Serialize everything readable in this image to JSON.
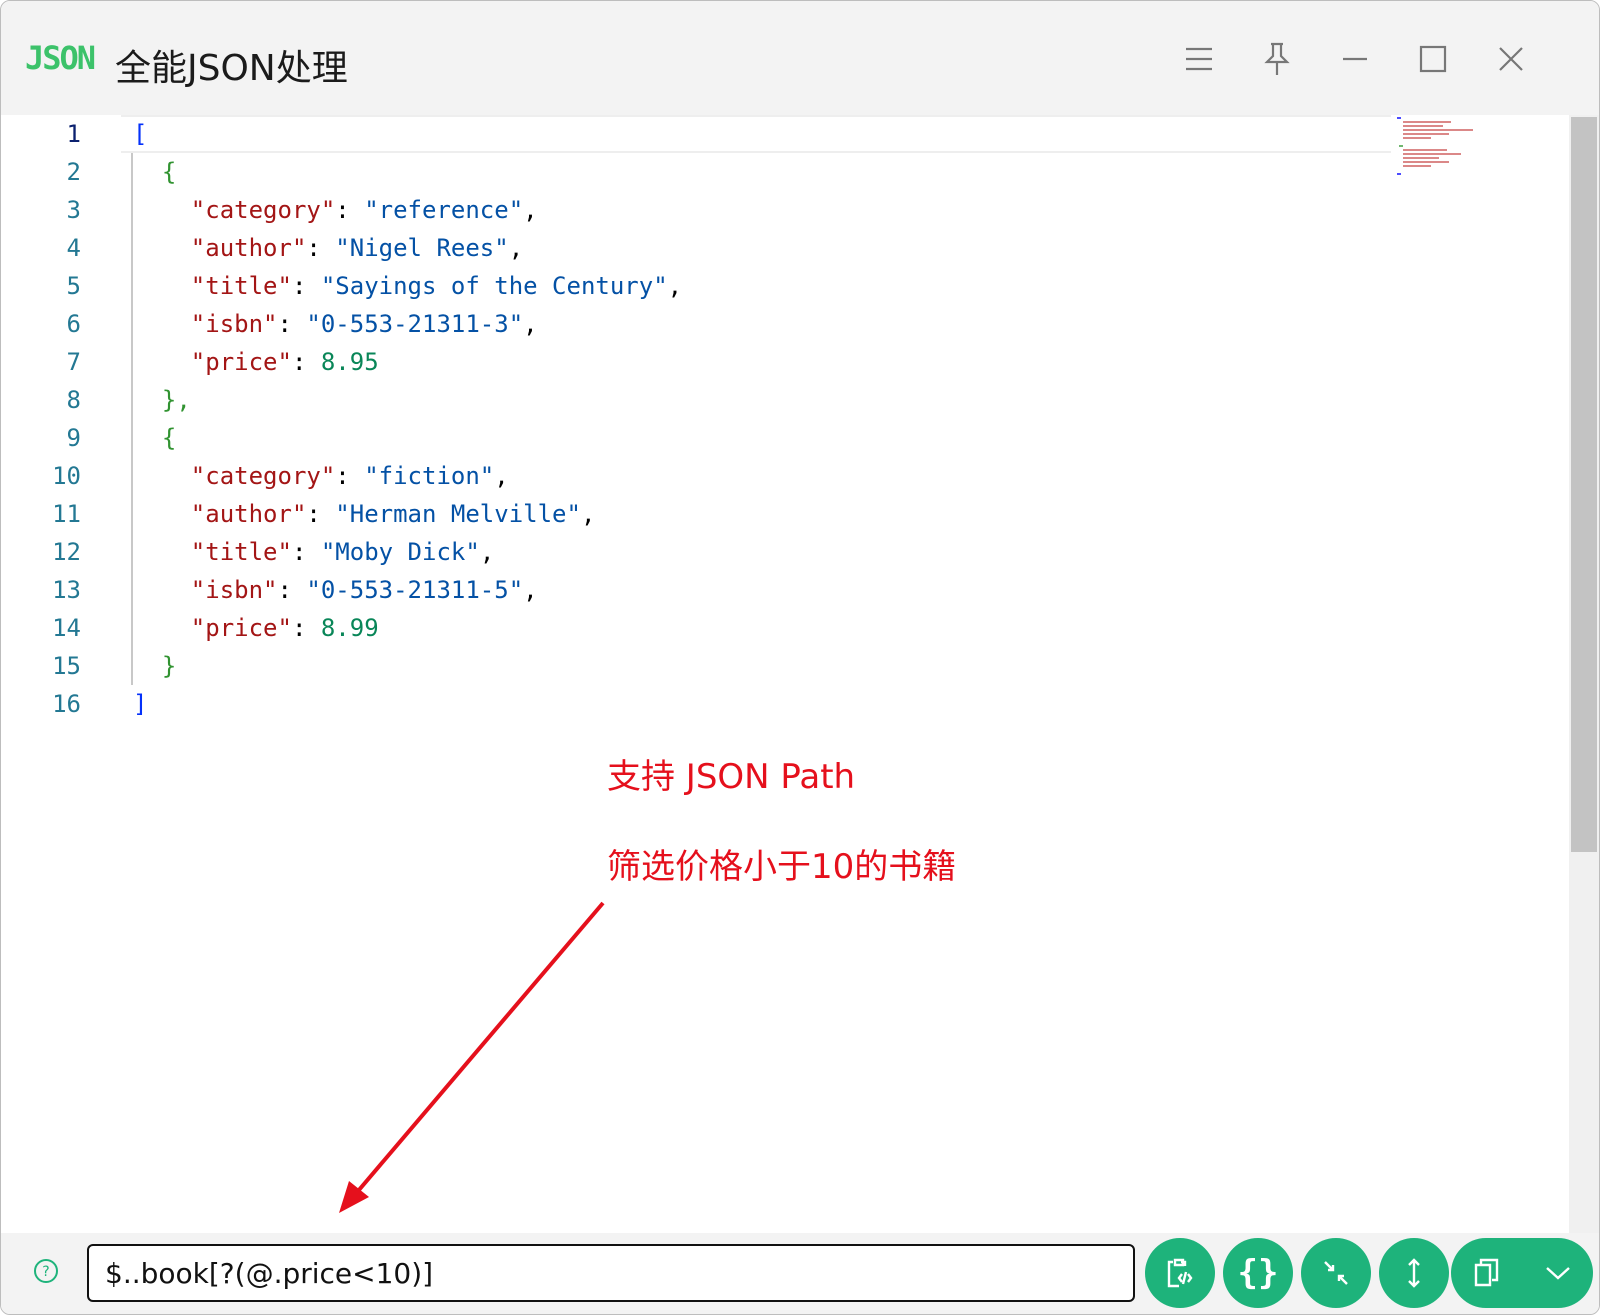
{
  "titlebar": {
    "logo": "JSON",
    "title": "全能JSON处理",
    "buttons": [
      "menu-icon",
      "pin-icon",
      "minimize-icon",
      "maximize-icon",
      "close-icon"
    ]
  },
  "editor": {
    "lines": [
      {
        "num": "1"
      },
      {
        "num": "2"
      },
      {
        "num": "3"
      },
      {
        "num": "4"
      },
      {
        "num": "5"
      },
      {
        "num": "6"
      },
      {
        "num": "7"
      },
      {
        "num": "8"
      },
      {
        "num": "9"
      },
      {
        "num": "10"
      },
      {
        "num": "11"
      },
      {
        "num": "12"
      },
      {
        "num": "13"
      },
      {
        "num": "14"
      },
      {
        "num": "15"
      },
      {
        "num": "16"
      }
    ],
    "books": [
      {
        "category_key": "\"category\"",
        "category": "\"reference\"",
        "author_key": "\"author\"",
        "author": "\"Nigel Rees\"",
        "title_key": "\"title\"",
        "title": "\"Sayings of the Century\"",
        "isbn_key": "\"isbn\"",
        "isbn": "\"0-553-21311-3\"",
        "price_key": "\"price\"",
        "price": "8.95"
      },
      {
        "category_key": "\"category\"",
        "category": "\"fiction\"",
        "author_key": "\"author\"",
        "author": "\"Herman Melville\"",
        "title_key": "\"title\"",
        "title": "\"Moby Dick\"",
        "isbn_key": "\"isbn\"",
        "isbn": "\"0-553-21311-5\"",
        "price_key": "\"price\"",
        "price": "8.99"
      }
    ],
    "punct": {
      "open_bracket": "[",
      "close_bracket": "]",
      "open_brace": "{",
      "close_brace": "}",
      "close_brace_comma": "},",
      "colon": ": ",
      "comma": ","
    }
  },
  "annotation": {
    "line1": "支持 JSON Path",
    "line2": "筛选价格小于10的书籍",
    "color": "#e5101c"
  },
  "bottombar": {
    "help_icon": "help-circle-icon",
    "path_value": "$..book[?(@.price<10)]",
    "buttons": [
      "paste-code-icon",
      "format-braces-icon",
      "compress-icon",
      "expand-vertical-icon",
      "copy-icon",
      "chevron-down-icon"
    ],
    "accent": "#1eb37b"
  }
}
